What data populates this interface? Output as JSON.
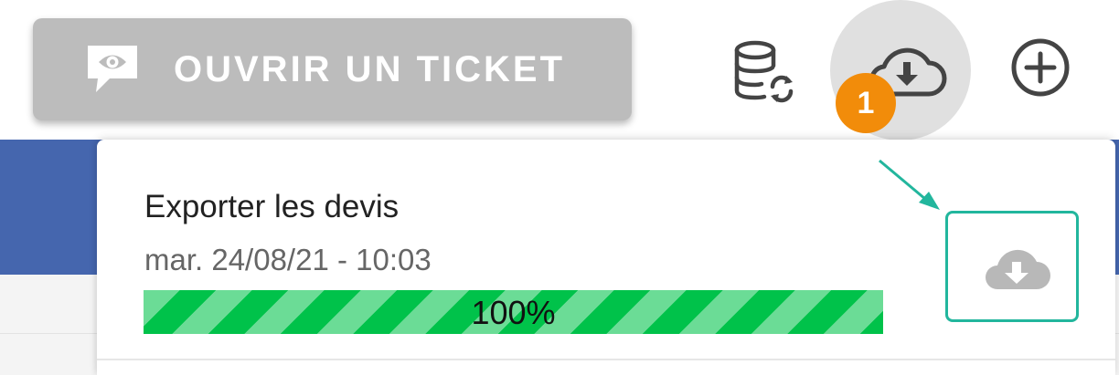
{
  "header": {
    "ticket_button_label": "OUVRIR UN TICKET",
    "icons": {
      "ticket": "eye-speech-bubble-icon",
      "database_sync": "database-sync-icon",
      "cloud_download": "cloud-download-icon",
      "add": "plus-circle-icon"
    },
    "notification_count": "1"
  },
  "export_panel": {
    "task_title": "Exporter les devis",
    "task_time": "mar. 24/08/21 - 10:03",
    "progress_label": "100%",
    "progress_value": 100,
    "download_icon": "cloud-download-icon"
  },
  "colors": {
    "header_blue": "#4566ae",
    "button_gray": "#bcbcbc",
    "badge_orange": "#f28c0a",
    "progress_green": "#00c24a",
    "highlight_teal": "#22b69d"
  }
}
